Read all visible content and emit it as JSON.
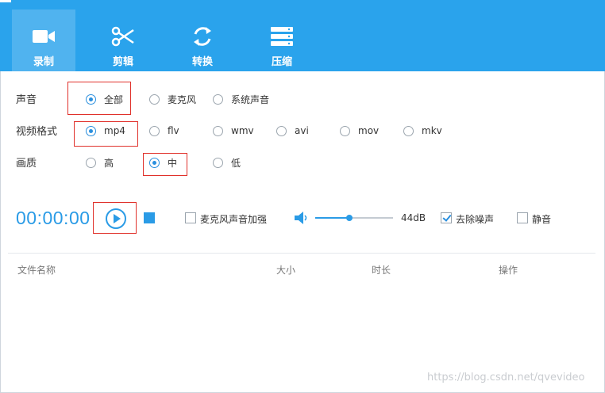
{
  "tabs": [
    {
      "label": "录制",
      "icon": "video-camera-icon",
      "active": true
    },
    {
      "label": "剪辑",
      "icon": "scissors-icon",
      "active": false
    },
    {
      "label": "转换",
      "icon": "refresh-icon",
      "active": false
    },
    {
      "label": "压缩",
      "icon": "server-stack-icon",
      "active": false
    }
  ],
  "sound": {
    "label": "声音",
    "options": [
      "全部",
      "麦克风",
      "系统声音"
    ],
    "selected": "全部"
  },
  "format": {
    "label": "视频格式",
    "options": [
      "mp4",
      "flv",
      "wmv",
      "avi",
      "mov",
      "mkv"
    ],
    "selected": "mp4"
  },
  "quality": {
    "label": "画质",
    "options": [
      "高",
      "中",
      "低"
    ],
    "selected": "中"
  },
  "controls": {
    "timer": "00:00:00",
    "mic_boost_label": "麦克风声音加强",
    "mic_boost_checked": false,
    "volume_db": "44dB",
    "volume_level": 0.44,
    "denoise_label": "去除噪声",
    "denoise_checked": true,
    "mute_label": "静音",
    "mute_checked": false
  },
  "table": {
    "columns": [
      "文件名称",
      "大小",
      "时长",
      "操作"
    ]
  },
  "watermark": "https://blog.csdn.net/qvevideo",
  "colors": {
    "header_bg": "#2aa3ec",
    "accent": "#2a9be6",
    "highlight_box": "#e0312b"
  }
}
